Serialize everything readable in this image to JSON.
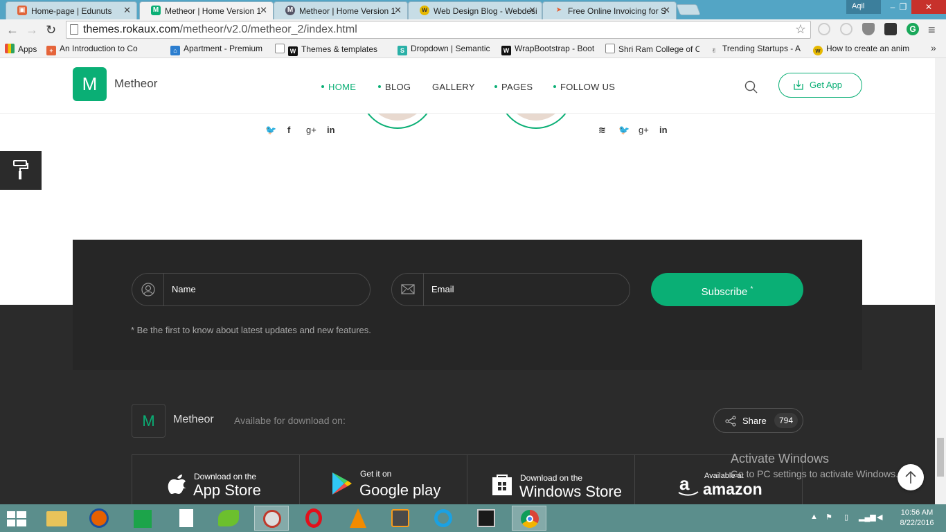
{
  "browser": {
    "tabs": [
      {
        "title": "Home-page | Edunuts",
        "favicon": "edunuts-icon",
        "active": false
      },
      {
        "title": "Metheor | Home Version 1",
        "favicon": "metheor-green-icon",
        "active": true
      },
      {
        "title": "Metheor | Home Version 1",
        "favicon": "metheor-grey-icon",
        "active": false
      },
      {
        "title": "Web Design Blog - Webdesi",
        "favicon": "webdesign-icon",
        "active": false
      },
      {
        "title": "Free Online Invoicing for S",
        "favicon": "invoicing-icon",
        "active": false
      }
    ],
    "window_user": "Aqil",
    "url": {
      "host": "themes.rokaux.com",
      "path": "/metheor/v2.0/metheor_2/index.html"
    },
    "bookmarks": [
      {
        "label": "Apps",
        "icon": "apps-grid-icon"
      },
      {
        "label": "An Introduction to Co",
        "icon": "plus-icon"
      },
      {
        "label": "Apartment - Premium",
        "icon": "house-icon"
      },
      {
        "label": "Themes & templates",
        "icon": "page-icon"
      },
      {
        "label": "Dropdown | Semantic",
        "icon": "s-icon"
      },
      {
        "label": "WrapBootstrap - Boot",
        "icon": "w-icon"
      },
      {
        "label": "Shri Ram College of C",
        "icon": "page-icon"
      },
      {
        "label": "Trending Startups - A",
        "icon": "hand-icon"
      },
      {
        "label": "How to create an anim",
        "icon": "w-yellow-icon"
      }
    ]
  },
  "site": {
    "logo_letter": "M",
    "logo_name": "Metheor",
    "nav": [
      {
        "label": "HOME",
        "active": true,
        "dot": true
      },
      {
        "label": "BLOG",
        "active": false,
        "dot": true
      },
      {
        "label": "GALLERY",
        "active": false,
        "dot": false
      },
      {
        "label": "PAGES",
        "active": false,
        "dot": true
      },
      {
        "label": "FOLLOW US",
        "active": false,
        "dot": true
      }
    ],
    "get_app": "Get App",
    "accent": "#0aaf75",
    "subscribe": {
      "name_placeholder": "Name",
      "email_placeholder": "Email",
      "button": "Subscribe",
      "button_mark": "*",
      "note": "* Be the first to know about latest updates and new features."
    },
    "footer": {
      "logo_letter": "M",
      "name": "Metheor",
      "available": "Availabe for download on:",
      "share_label": "Share",
      "share_count": "794",
      "stores": [
        {
          "line1": "Download on the",
          "line2": "App Store",
          "icon": "apple-icon"
        },
        {
          "line1": "Get it on",
          "line2": "Google play",
          "icon": "google-play-icon"
        },
        {
          "line1": "Download on the",
          "line2": "Windows Store",
          "icon": "windows-icon"
        },
        {
          "line1": "Available at",
          "line2": "amazon",
          "icon": "amazon-icon"
        }
      ]
    }
  },
  "overlay": {
    "activate_title": "Activate Windows",
    "activate_sub": "Go to PC settings to activate Windows."
  },
  "taskbar": {
    "time": "10:56 AM",
    "date": "8/22/2016"
  }
}
